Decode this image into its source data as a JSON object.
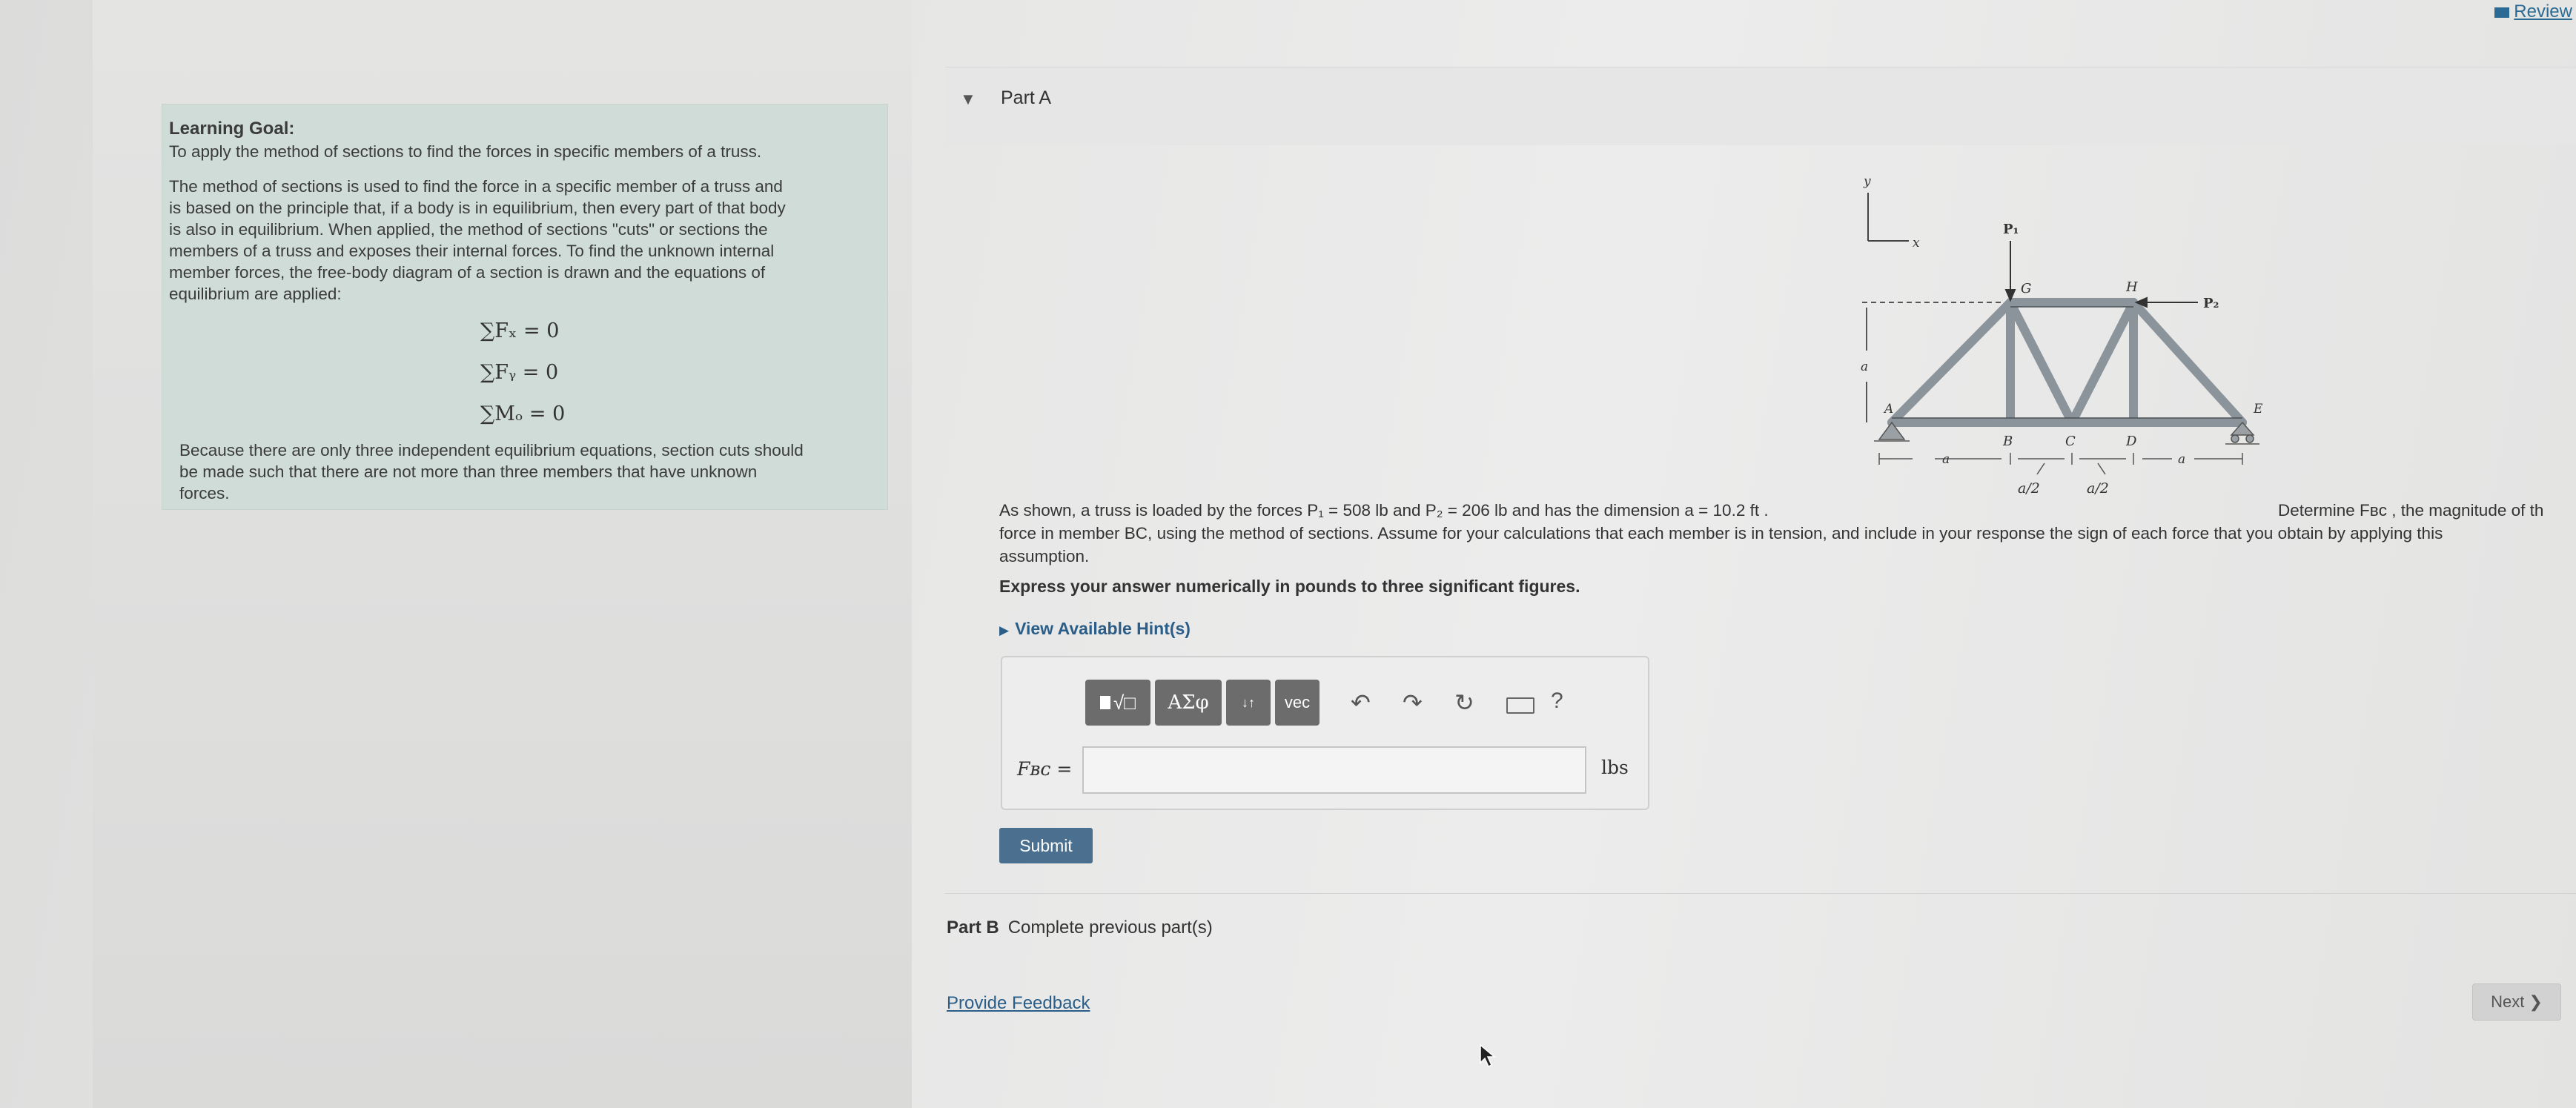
{
  "header": {
    "review_label": "Review"
  },
  "learning_goal": {
    "title": "Learning Goal:",
    "subtitle": "To apply the method of sections to find the forces in specific members of a truss.",
    "paragraph_lines": [
      "The method of sections is used to find the force in a specific member of a truss and",
      "is based on the principle that, if a body is in equilibrium, then every part of that body",
      "is also in equilibrium.  When applied, the method of sections \"cuts\" or sections the",
      "members of a truss and exposes their internal forces.  To find the unknown internal",
      "member forces, the free-body diagram of a section is drawn and the equations of",
      "equilibrium are applied:"
    ],
    "equations": [
      "∑Fₓ = 0",
      "∑Fᵧ = 0",
      "∑Mₒ = 0"
    ],
    "outro_lines": [
      "Because there are only three independent equilibrium equations, section cuts should",
      "be made such that there are not more than three members that have unknown",
      "forces."
    ]
  },
  "part_a": {
    "title": "Part A",
    "problem_line1_left": "As shown, a truss is loaded by the forces P₁ = 508 lb and P₂ = 206 lb and has the dimension a = 10.2 ft .",
    "problem_line1_right": "Determine  Fʙᴄ , the magnitude of th",
    "problem_line2": "force in member BC, using the method of sections. Assume for your calculations that each member is in tension, and include in your response the sign of each force that you obtain by applying this",
    "problem_line3": "assumption.",
    "express": "Express your answer numerically in pounds to three significant figures.",
    "hints_label": "View Available Hint(s)",
    "toolbar": {
      "templates_label": "√□",
      "symbols_label": "ΑΣφ",
      "sort_label": "↓↑",
      "vec_label": "vec",
      "help_label": "?"
    },
    "answer_label": "Fʙᴄ =",
    "answer_value": "",
    "unit_label": "lbs",
    "submit_label": "Submit"
  },
  "figure": {
    "labels": {
      "y": "y",
      "x": "x",
      "p1": "P₁",
      "p2": "P₂",
      "g": "G",
      "h": "H",
      "a_left": "A",
      "b": "B",
      "c": "C",
      "d": "D",
      "e": "E",
      "a_dim": "a",
      "bottom_a1": "a",
      "bottom_a2": "a",
      "half1": "a/2",
      "half2": "a/2"
    }
  },
  "part_b": {
    "label": "Part B",
    "status": "Complete previous part(s)"
  },
  "footer": {
    "feedback_label": "Provide Feedback",
    "next_label": "Next ❯"
  }
}
